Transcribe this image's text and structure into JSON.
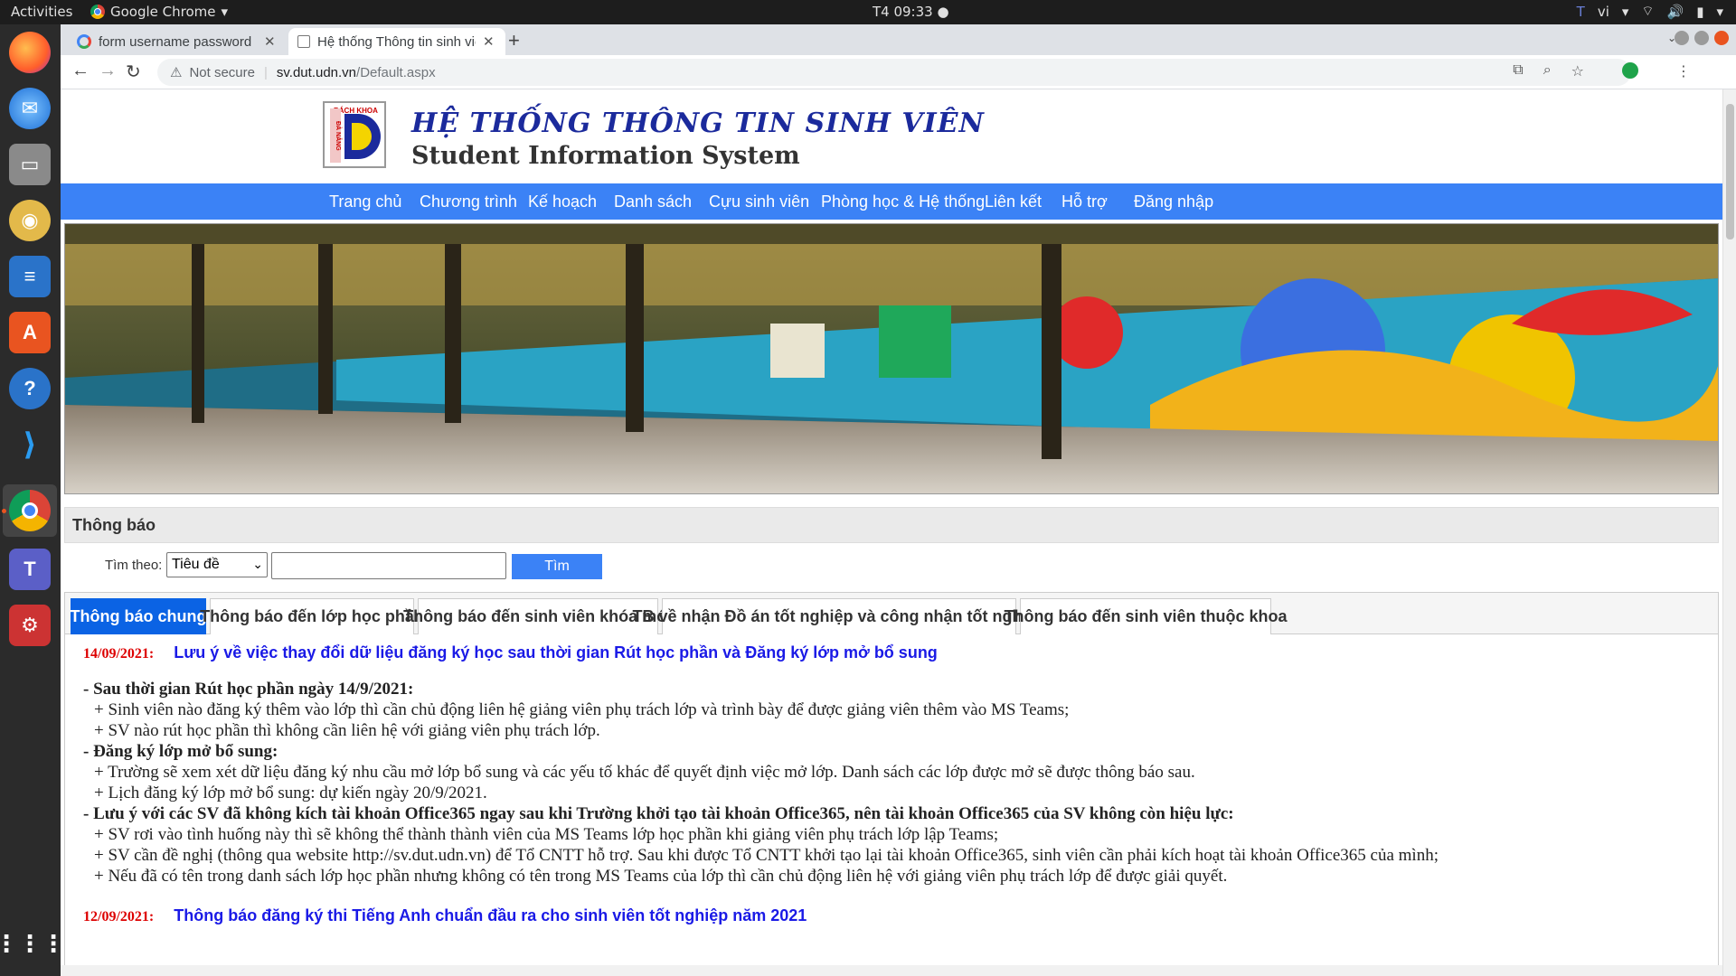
{
  "os": {
    "activities": "Activities",
    "app_name": "Google Chrome",
    "clock": "T4 09:33",
    "lang": "vi",
    "accent": "#e95420"
  },
  "browser": {
    "tabs": [
      {
        "title": "form username password",
        "active": false
      },
      {
        "title": "Hệ thống Thông tin sinh viên",
        "active": true
      }
    ],
    "security": "Not secure",
    "url_host": "sv.dut.udn.vn",
    "url_path": "/Default.aspx"
  },
  "site": {
    "logo_text": "BÁCH KHOA",
    "logo_side": "ĐÀ NẴNG",
    "title_vi": "HỆ THỐNG THÔNG TIN SINH VIÊN",
    "title_en": "Student Information System",
    "nav": [
      "Trang chủ",
      "Chương trình",
      "Kế hoạch",
      "Danh sách",
      "Cựu sinh viên",
      "Phòng học & Hệ thống",
      "Liên kết",
      "Hỗ trợ",
      "Đăng nhập"
    ],
    "nav_color": "#3b82f6"
  },
  "notice_panel": {
    "heading": "Thông báo",
    "search_label": "Tìm theo:",
    "search_select": "Tiêu đề",
    "search_button": "Tìm",
    "tabs": [
      "Thông báo chung",
      "Thông báo đến lớp học phần",
      "Thông báo đến sinh viên khóa mới",
      "TB về nhận Đồ án tốt nghiệp và công nhận tốt nghiệp",
      "Thông báo đến sinh viên thuộc khoa"
    ],
    "active_tab": 0
  },
  "notices": [
    {
      "date": "14/09/2021:",
      "title": "Lưu ý về việc thay đổi dữ liệu đăng ký học sau thời gian Rút học phần và Đăng ký lớp mở bổ sung",
      "lines": [
        {
          "text": "- Sau thời gian Rút học phần ngày 14/9/2021:",
          "bold": true
        },
        {
          "text": "+ Sinh viên nào đăng ký thêm vào lớp thì cần chủ động liên hệ giảng viên phụ trách lớp và trình bày để được giảng viên thêm vào MS Teams;",
          "bold": false
        },
        {
          "text": "+ SV nào rút học phần thì không cần liên hệ với giảng viên phụ trách lớp.",
          "bold": false
        },
        {
          "text": "- Đăng ký lớp mở bổ sung:",
          "bold": true
        },
        {
          "text": "+ Trường sẽ xem xét dữ liệu đăng ký nhu cầu mở lớp bổ sung và các yếu tố khác để quyết định việc mở lớp. Danh sách các lớp được mở sẽ được thông báo sau.",
          "bold": false
        },
        {
          "text": "+ Lịch đăng ký lớp mở bổ sung: dự kiến ngày 20/9/2021.",
          "bold": false
        },
        {
          "text": "- Lưu ý với các SV đã không kích tài khoản Office365 ngay sau khi Trường khởi tạo tài khoản Office365, nên tài khoản Office365 của SV không còn hiệu lực:",
          "bold": true
        },
        {
          "text": "+ SV rơi vào tình huống này thì sẽ không thể thành thành viên của MS Teams lớp học phần khi giảng viên phụ trách lớp lập Teams;",
          "bold": false
        },
        {
          "text": "+ SV cần đề nghị (thông qua website http://sv.dut.udn.vn) để Tổ CNTT hỗ trợ. Sau khi được Tổ CNTT khởi tạo lại tài khoản Office365, sinh viên cần phải kích hoạt tài khoản Office365 của mình;",
          "bold": false
        },
        {
          "text": "+ Nếu đã có tên trong danh sách lớp học phần nhưng không có tên trong MS Teams của lớp thì cần chủ động liên hệ với giảng viên phụ trách lớp để được giải quyết.",
          "bold": false
        }
      ]
    },
    {
      "date": "12/09/2021:",
      "title": "Thông báo đăng ký thi Tiếng Anh chuẩn đầu ra cho sinh viên tốt nghiệp năm 2021",
      "lines": []
    }
  ]
}
